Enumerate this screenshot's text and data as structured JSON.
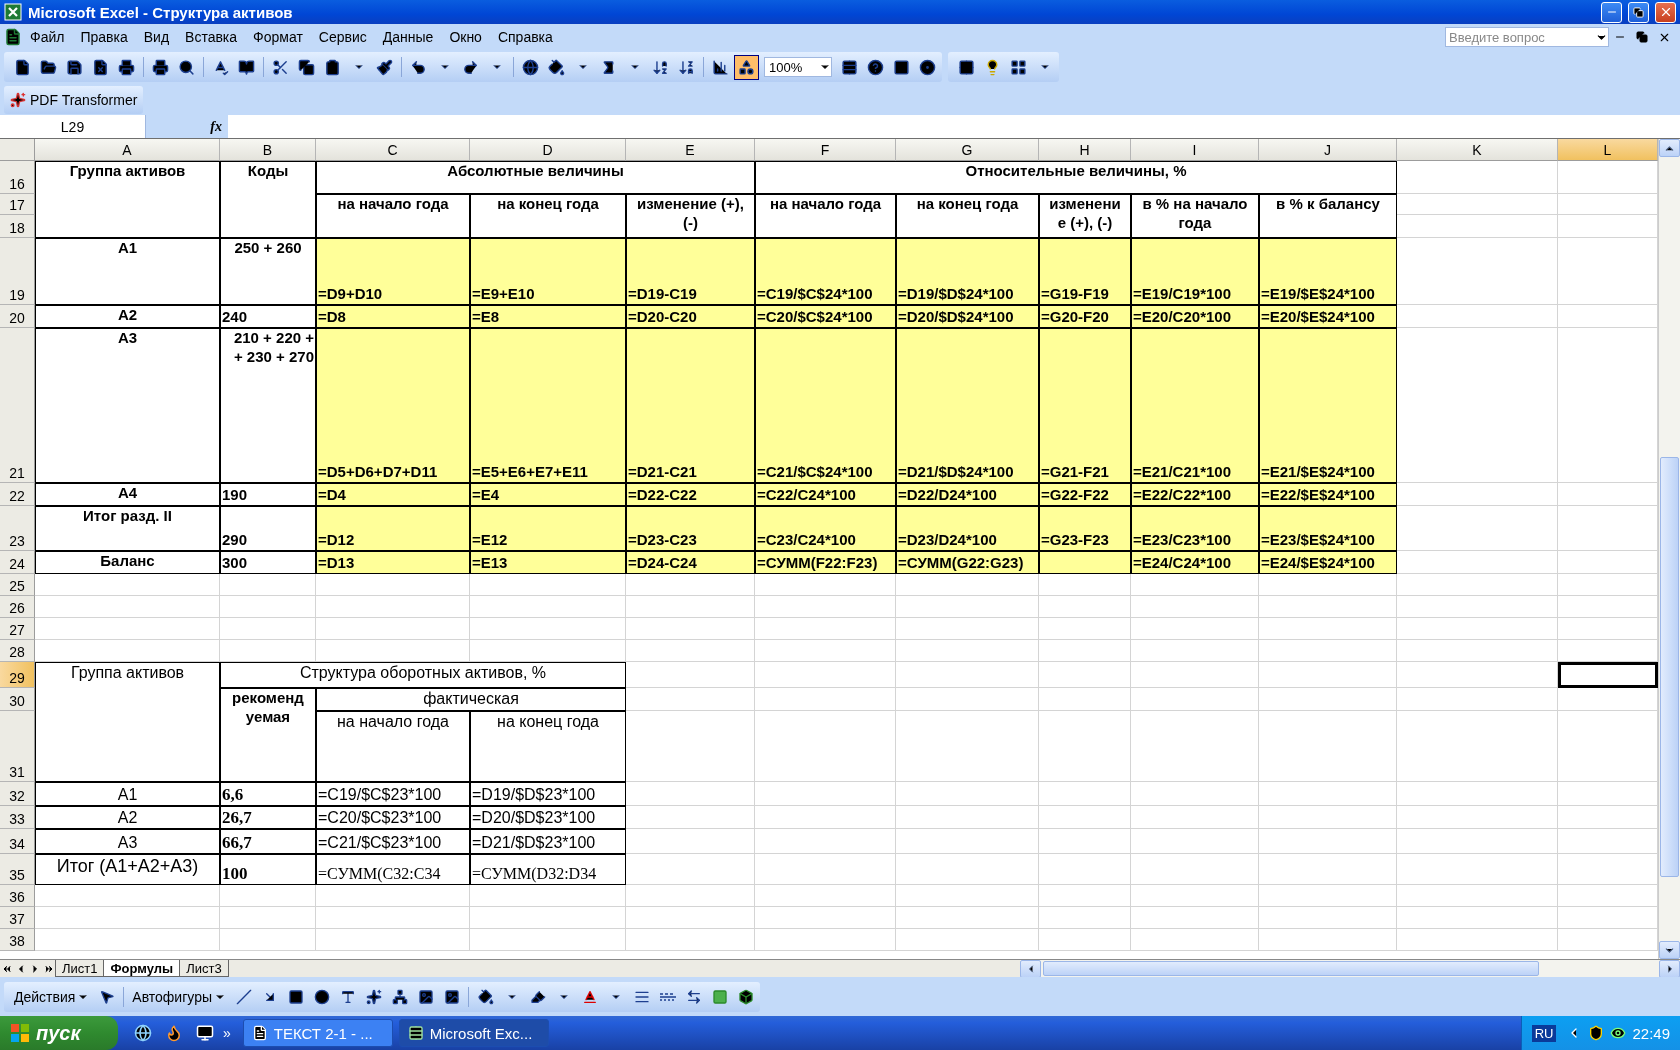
{
  "window": {
    "title": "Microsoft Excel - Структура активов"
  },
  "menu": [
    "Файл",
    "Правка",
    "Вид",
    "Вставка",
    "Формат",
    "Сервис",
    "Данные",
    "Окно",
    "Справка"
  ],
  "help_box": {
    "placeholder": "Введите вопрос"
  },
  "toolbar": {
    "zoom": "100%"
  },
  "pdf_toolbar": {
    "label": "PDF Transformer"
  },
  "formula_bar": {
    "name_box": "L29",
    "function_label": "fx"
  },
  "columns": [
    {
      "label": "A",
      "selected": false
    },
    {
      "label": "B",
      "selected": false
    },
    {
      "label": "C",
      "selected": false
    },
    {
      "label": "D",
      "selected": false
    },
    {
      "label": "E",
      "selected": false
    },
    {
      "label": "F",
      "selected": false
    },
    {
      "label": "G",
      "selected": false
    },
    {
      "label": "H",
      "selected": false
    },
    {
      "label": "I",
      "selected": false
    },
    {
      "label": "J",
      "selected": false
    },
    {
      "label": "K",
      "selected": false
    },
    {
      "label": "L",
      "selected": true
    }
  ],
  "rows": [
    {
      "label": "16",
      "selected": false
    },
    {
      "label": "17",
      "selected": false
    },
    {
      "label": "18",
      "selected": false
    },
    {
      "label": "19",
      "selected": false
    },
    {
      "label": "20",
      "selected": false
    },
    {
      "label": "21",
      "selected": false
    },
    {
      "label": "22",
      "selected": false
    },
    {
      "label": "23",
      "selected": false
    },
    {
      "label": "24",
      "selected": false
    },
    {
      "label": "25",
      "selected": false
    },
    {
      "label": "26",
      "selected": false
    },
    {
      "label": "27",
      "selected": false
    },
    {
      "label": "28",
      "selected": false
    },
    {
      "label": "29",
      "selected": true
    },
    {
      "label": "30",
      "selected": false
    },
    {
      "label": "31",
      "selected": false
    },
    {
      "label": "32",
      "selected": false
    },
    {
      "label": "33",
      "selected": false
    },
    {
      "label": "34",
      "selected": false
    },
    {
      "label": "35",
      "selected": false
    },
    {
      "label": "36",
      "selected": false
    },
    {
      "label": "37",
      "selected": false
    },
    {
      "label": "38",
      "selected": false
    }
  ],
  "cells": [
    {
      "text": "Группа активов",
      "kind": "heading",
      "highlighted": false
    },
    {
      "text": "Коды",
      "kind": "heading",
      "highlighted": false
    },
    {
      "text": "Абсолютные величины",
      "kind": "heading",
      "highlighted": false
    },
    {
      "text": "Относительные величины, %",
      "kind": "heading",
      "highlighted": false
    },
    {
      "text": "на начало года",
      "kind": "heading",
      "highlighted": false
    },
    {
      "text": "на конец года",
      "kind": "heading",
      "highlighted": false
    },
    {
      "text": "изменение (+), (-)",
      "kind": "heading",
      "highlighted": false
    },
    {
      "text": "на начало года",
      "kind": "heading",
      "highlighted": false
    },
    {
      "text": "на конец года",
      "kind": "heading",
      "highlighted": false
    },
    {
      "text": "изменение (+), (-)",
      "kind": "split",
      "highlighted": false
    },
    {
      "text": "в % на начало года",
      "kind": "heading",
      "highlighted": false
    },
    {
      "text": "в % к балансу",
      "kind": "heading",
      "highlighted": false
    },
    {
      "text": "А1",
      "kind": "heading",
      "highlighted": false
    },
    {
      "text": "250 + 260",
      "kind": "heading",
      "highlighted": false
    },
    {
      "text": "=D9+D10",
      "kind": "entry",
      "highlighted": true
    },
    {
      "text": "=E9+E10",
      "kind": "entry",
      "highlighted": true
    },
    {
      "text": "=D19-C19",
      "kind": "entry",
      "highlighted": true
    },
    {
      "text": "=C19/$C$24*100",
      "kind": "entry",
      "highlighted": true
    },
    {
      "text": "=D19/$D$24*100",
      "kind": "entry",
      "highlighted": true
    },
    {
      "text": "=G19-F19",
      "kind": "entry",
      "highlighted": true
    },
    {
      "text": "=E19/C19*100",
      "kind": "entry",
      "highlighted": true
    },
    {
      "text": "=E19/$E$24*100",
      "kind": "entry",
      "highlighted": true
    },
    {
      "text": "А2",
      "kind": "heading",
      "highlighted": false
    },
    {
      "text": "240",
      "kind": "entry",
      "highlighted": false
    },
    {
      "text": "=D8",
      "kind": "entry",
      "highlighted": true
    },
    {
      "text": "=E8",
      "kind": "entry",
      "highlighted": true
    },
    {
      "text": "=D20-C20",
      "kind": "entry",
      "highlighted": true
    },
    {
      "text": "=C20/$C$24*100",
      "kind": "entry",
      "highlighted": true
    },
    {
      "text": "=D20/$D$24*100",
      "kind": "entry",
      "highlighted": true
    },
    {
      "text": "=G20-F20",
      "kind": "entry",
      "highlighted": true
    },
    {
      "text": "=E20/C20*100",
      "kind": "entry",
      "highlighted": true
    },
    {
      "text": "=E20/$E$24*100",
      "kind": "entry",
      "highlighted": true
    },
    {
      "text": "А3",
      "kind": "heading",
      "highlighted": false
    },
    {
      "text": "210 + 220 + + 230 + 270",
      "kind": "code",
      "highlighted": false
    },
    {
      "text": "=D5+D6+D7+D11",
      "kind": "entry",
      "highlighted": true
    },
    {
      "text": "=E5+E6+E7+E11",
      "kind": "entry",
      "highlighted": true
    },
    {
      "text": "=D21-C21",
      "kind": "entry",
      "highlighted": true
    },
    {
      "text": "=C21/$C$24*100",
      "kind": "entry",
      "highlighted": true
    },
    {
      "text": "=D21/$D$24*100",
      "kind": "entry",
      "highlighted": true
    },
    {
      "text": "=G21-F21",
      "kind": "entry",
      "highlighted": true
    },
    {
      "text": "=E21/C21*100",
      "kind": "entry",
      "highlighted": true
    },
    {
      "text": "=E21/$E$24*100",
      "kind": "entry",
      "highlighted": true
    },
    {
      "text": "А4",
      "kind": "heading",
      "highlighted": false
    },
    {
      "text": "190",
      "kind": "entry",
      "highlighted": false
    },
    {
      "text": "=D4",
      "kind": "entry",
      "highlighted": true
    },
    {
      "text": "=E4",
      "kind": "entry",
      "highlighted": true
    },
    {
      "text": "=D22-C22",
      "kind": "entry",
      "highlighted": true
    },
    {
      "text": "=C22/C24*100",
      "kind": "entry",
      "highlighted": true
    },
    {
      "text": "=D22/D24*100",
      "kind": "entry",
      "highlighted": true
    },
    {
      "text": "=G22-F22",
      "kind": "entry",
      "highlighted": true
    },
    {
      "text": "=E22/C22*100",
      "kind": "entry",
      "highlighted": true
    },
    {
      "text": "=E22/$E$24*100",
      "kind": "entry",
      "highlighted": true
    },
    {
      "text": "Итог разд. II",
      "kind": "heading",
      "highlighted": false
    },
    {
      "text": "290",
      "kind": "entry",
      "highlighted": false
    },
    {
      "text": "=D12",
      "kind": "entry",
      "highlighted": true
    },
    {
      "text": "=E12",
      "kind": "entry",
      "highlighted": true
    },
    {
      "text": "=D23-C23",
      "kind": "entry",
      "highlighted": true
    },
    {
      "text": "=C23/C24*100",
      "kind": "entry",
      "highlighted": true
    },
    {
      "text": "=D23/D24*100",
      "kind": "entry",
      "highlighted": true
    },
    {
      "text": "=G23-F23",
      "kind": "entry",
      "highlighted": true
    },
    {
      "text": "=E23/C23*100",
      "kind": "entry",
      "highlighted": true
    },
    {
      "text": "=E23/$E$24*100",
      "kind": "entry",
      "highlighted": true
    },
    {
      "text": "Баланс",
      "kind": "heading",
      "highlighted": false
    },
    {
      "text": "300",
      "kind": "entry",
      "highlighted": false
    },
    {
      "text": "=D13",
      "kind": "entry",
      "highlighted": true
    },
    {
      "text": "=E13",
      "kind": "entry",
      "highlighted": true
    },
    {
      "text": "=D24-C24",
      "kind": "entry",
      "highlighted": true
    },
    {
      "text": "=СУММ(F22:F23)",
      "kind": "entry",
      "highlighted": true
    },
    {
      "text": "=СУММ(G22:G23)",
      "kind": "entry",
      "highlighted": true
    },
    {
      "kind": "entry",
      "highlighted": true
    },
    {
      "text": "=E24/C24*100",
      "kind": "entry",
      "highlighted": true
    },
    {
      "text": "=E24/$E$24*100",
      "kind": "entry",
      "highlighted": true
    },
    {
      "text": "Группа активов",
      "kind": "caption",
      "highlighted": false
    },
    {
      "text": "Структура оборотных активов, %",
      "kind": "caption",
      "highlighted": false
    },
    {
      "text": "рекомендуемая",
      "kind": "split",
      "highlighted": false
    },
    {
      "text": "фактическая",
      "kind": "caption",
      "highlighted": false
    },
    {
      "text": "на начало года",
      "kind": "caption",
      "highlighted": false
    },
    {
      "text": "на конец года",
      "kind": "caption",
      "highlighted": false
    },
    {
      "text": "А1",
      "kind": "label",
      "highlighted": false
    },
    {
      "text": "6,6",
      "kind": "number",
      "highlighted": false
    },
    {
      "text": "=C19/$C$23*100",
      "kind": "formula",
      "highlighted": false
    },
    {
      "text": "=D19/$D$23*100",
      "kind": "formula",
      "highlighted": false
    },
    {
      "text": "А2",
      "kind": "label",
      "highlighted": false
    },
    {
      "text": "26,7",
      "kind": "number",
      "highlighted": false
    },
    {
      "text": "=C20/$C$23*100",
      "kind": "formula",
      "highlighted": false
    },
    {
      "text": "=D20/$D$23*100",
      "kind": "formula",
      "highlighted": false
    },
    {
      "text": "А3",
      "kind": "label",
      "highlighted": false
    },
    {
      "text": "66,7",
      "kind": "number",
      "highlighted": false
    },
    {
      "text": "=C21/$C$23*100",
      "kind": "formula",
      "highlighted": false
    },
    {
      "text": "=D21/$D$23*100",
      "kind": "formula",
      "highlighted": false
    },
    {
      "text": "Итог (А1+А2+А3)",
      "kind": "total",
      "highlighted": false
    },
    {
      "text": "100",
      "kind": "number",
      "highlighted": false
    },
    {
      "text": "=СУММ(C32:C34",
      "kind": "serif",
      "highlighted": false
    },
    {
      "text": "=СУММ(D32:D34",
      "kind": "serif",
      "highlighted": false
    }
  ],
  "sheet_tabs": [
    {
      "label": "Лист1",
      "selected": false
    },
    {
      "label": "Формулы",
      "selected": true
    },
    {
      "label": "Лист3",
      "selected": false
    }
  ],
  "drawing_toolbar": {
    "actions": "Действия",
    "autoshapes": "Автофигуры"
  },
  "taskbar": {
    "start": "пуск",
    "more": "»",
    "tasks": [
      {
        "label": "ТЕКСТ 2-1 - ...",
        "selected": false
      },
      {
        "label": "Microsoft Exc...",
        "selected": true
      }
    ],
    "language": "RU",
    "clock": "22:49"
  }
}
